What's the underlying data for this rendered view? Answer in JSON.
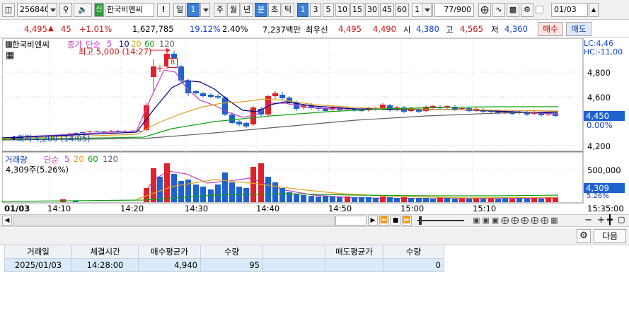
{
  "toolbar": {
    "code": "256840",
    "sin_badge": "신",
    "stock_name": "한국비엔씨",
    "bang": "!",
    "period_day": "일",
    "period_day_num": "1",
    "period_tabs": [
      "주",
      "월",
      "년"
    ],
    "period_min": "분",
    "period_cho": "초",
    "period_tick": "틱",
    "interval_buttons": [
      "1",
      "3",
      "5",
      "10",
      "15",
      "30",
      "45",
      "60"
    ],
    "interval_selected": "1",
    "interval_input": "1",
    "count": "77/900",
    "date": "01/03"
  },
  "quote": {
    "price": "4,495",
    "arrow": "▲",
    "change": "45",
    "change_pct": "+1.01%",
    "volume": "1,627,785",
    "vol_ratio": "19.12%",
    "turnover": "2.40%",
    "amount": "7,237백만",
    "best_label": "최우선",
    "best_ask": "4,495",
    "best_bid": "4,490",
    "open_label": "시",
    "open": "4,380",
    "high_label": "고",
    "high": "4,565",
    "low_label": "저",
    "low": "4,360",
    "buy_label": "매수",
    "sell_label": "매도"
  },
  "chart": {
    "price_legend_name": "한국비엔씨",
    "price_legend_close": "종가",
    "price_legend_ma": "단순",
    "ma_periods": [
      "5",
      "10",
      "20",
      "60",
      "120"
    ],
    "high_annotation": "최고 5,000 (14:27)",
    "low_annotation": "최저 4,200 (14:05)",
    "buy_marker": "B",
    "lc_label": "LC:4,46",
    "hc_label": "HC:-11,00",
    "price_ticks": [
      "4,800",
      "4,600",
      "4,200"
    ],
    "current_price_tag": "4,450",
    "current_pct": "0.00%",
    "volume_legend_name": "거래량",
    "volume_legend_ma": "단순",
    "volume_info": "4,309주(5.26%)",
    "volume_ticks": [
      "500,000"
    ],
    "current_volume_tag": "4,309",
    "current_volume_pct": "5.26%",
    "date_label": "01/03",
    "time_ticks": [
      "14:10",
      "14:20",
      "14:30",
      "14:40",
      "14:50",
      "15:00",
      "15:10"
    ],
    "end_time": "15:35:00",
    "colors": {
      "up": "#e0202a",
      "down": "#1e62d0",
      "ma5": "#c040c0",
      "ma10": "#000080",
      "ma20": "#e0a020",
      "ma60": "#10a010",
      "ma120": "#606060"
    }
  },
  "panel": {
    "next_label": "다음",
    "headers": [
      "거래일",
      "체결시간",
      "매수평균가",
      "수량",
      "",
      "매도평균가",
      "수량"
    ],
    "rows": [
      [
        "2025/01/03",
        "14:28:00",
        "4,940",
        "95",
        "",
        "",
        "0"
      ]
    ]
  }
}
